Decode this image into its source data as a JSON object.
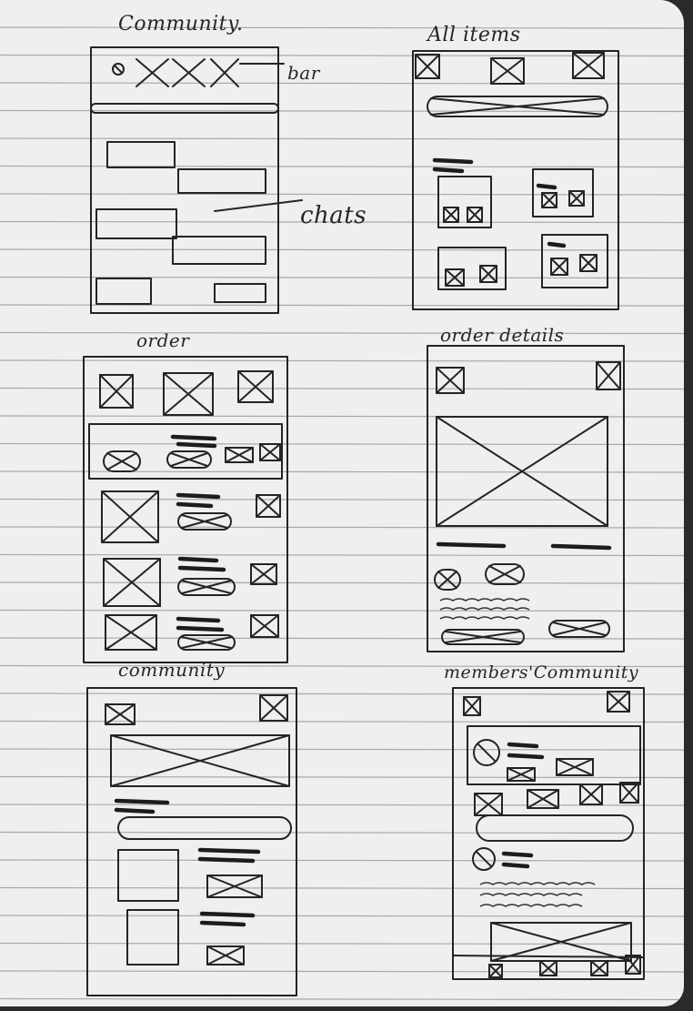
{
  "sketch": {
    "ink_color": "#242424",
    "paper_color": "#efefed",
    "rule_color": "#a9a9a9",
    "labels": {
      "community_top": "Community.",
      "bar": "bar",
      "chats": "chats",
      "all_items": "All items",
      "order": "order",
      "order_details": "order details",
      "community_bottom": "community",
      "members_community": "members'Community"
    }
  }
}
